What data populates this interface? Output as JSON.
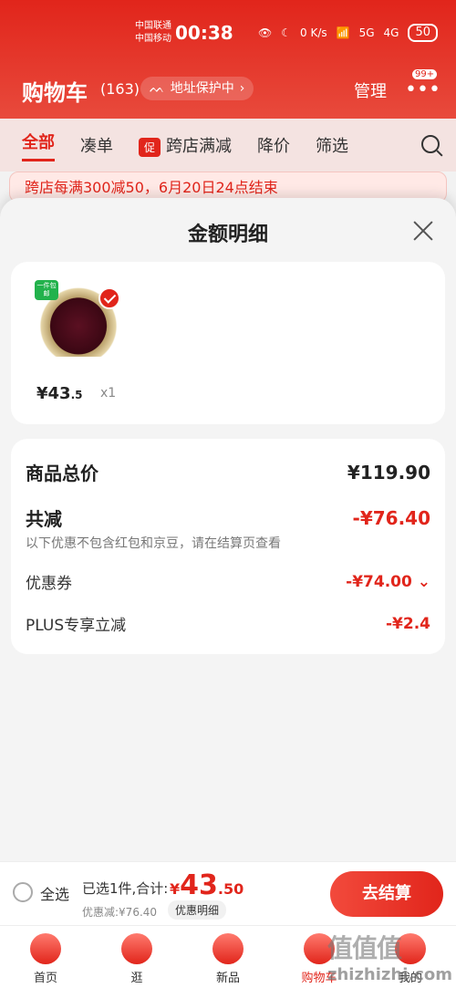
{
  "status_bar": {
    "carrier1": "中国联通",
    "carrier2": "中国移动",
    "time": "00:38",
    "speed": "0\nK/s",
    "network1": "5G",
    "network2": "4G",
    "battery": "50"
  },
  "header": {
    "title": "购物车",
    "count": "(163)",
    "address_protection": "地址保护中",
    "manage": "管理",
    "more_badge": "99+"
  },
  "tabs": [
    {
      "label": "全部"
    },
    {
      "label": "凑单"
    },
    {
      "tag": "促",
      "label": "跨店满减"
    },
    {
      "label": "降价"
    },
    {
      "label": "筛选"
    }
  ],
  "banner": {
    "text": "跨店每满300减50，6月20日24点结束"
  },
  "sheet": {
    "title": "金额明细",
    "product": {
      "badge": "一件包邮",
      "price_main": "¥43",
      "price_dec": ".5",
      "quantity": "x1"
    },
    "summary": {
      "total_label": "商品总价",
      "total_value": "¥119.90",
      "reduction_label": "共减",
      "reduction_value": "-¥76.40",
      "note": "以下优惠不包含红包和京豆，请在结算页查看",
      "coupon_label": "优惠券",
      "coupon_value": "-¥74.00",
      "plus_label": "PLUS专享立减",
      "plus_value": "-¥2.4"
    }
  },
  "checkout": {
    "select_all": "全选",
    "selected_info": "已选1件,合计:",
    "total_yen": "¥",
    "total_int": "43",
    "total_dec": ".50",
    "discount_text": "优惠减:¥76.40",
    "detail_button": "优惠明细",
    "checkout_button": "去结算"
  },
  "nav": [
    {
      "label": "首页"
    },
    {
      "label": "逛"
    },
    {
      "label": "新品"
    },
    {
      "label": "购物车"
    },
    {
      "label": "我的"
    }
  ],
  "watermark": {
    "line1": "值值值",
    "line2": "zhizhizhi.com"
  },
  "colors": {
    "brand": "#e1251b",
    "sheet_bg": "#f4f4f4",
    "card_bg": "#ffffff"
  }
}
